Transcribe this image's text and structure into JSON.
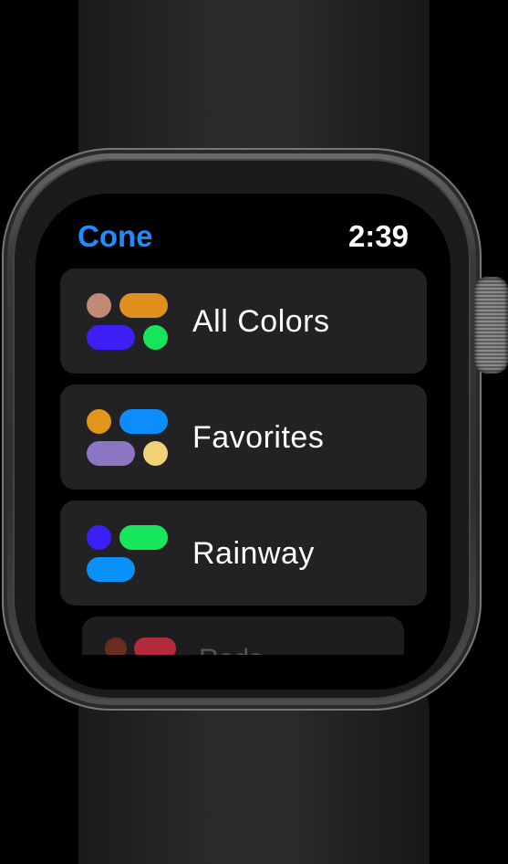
{
  "app": {
    "title": "Cone",
    "time": "2:39"
  },
  "lists": [
    {
      "label": "All Colors",
      "swatches": [
        "#c08b74",
        "#e0901e",
        "#3d1ef5",
        "#16e55a"
      ]
    },
    {
      "label": "Favorites",
      "swatches": [
        "#e1951d",
        "#0d8dfc",
        "#8c76c4",
        "#f0d178"
      ]
    },
    {
      "label": "Rainway",
      "swatches": [
        "#3a1ef6",
        "#17e65c",
        "#0a90fb"
      ]
    },
    {
      "label": "Reds",
      "swatches": [
        "#6a2c22",
        "#b22b3d"
      ]
    }
  ]
}
